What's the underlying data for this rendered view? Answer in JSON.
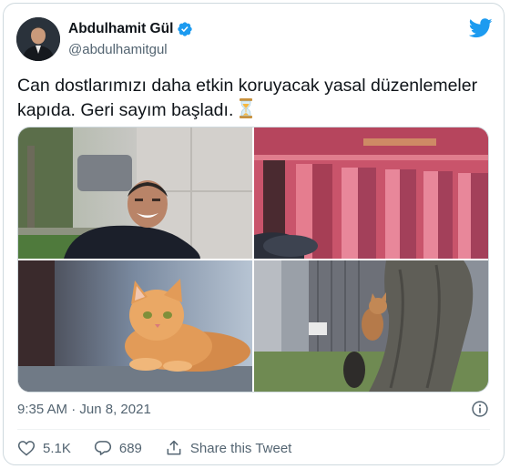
{
  "author": {
    "display_name": "Abdulhamit Gül",
    "handle": "@abdulhamitgul",
    "verified": true
  },
  "tweet": {
    "text": "Can dostlarımızı daha etkin koruyacak yasal düzenlemeler kapıda. Geri sayım başladı."
  },
  "media": {
    "photos": [
      {
        "subject": "man-crouching-smiling"
      },
      {
        "subject": "pink-building-facade"
      },
      {
        "subject": "orange-kitten"
      },
      {
        "subject": "kitten-climbing-tree"
      }
    ]
  },
  "meta": {
    "time": "9:35 AM",
    "separator": " · ",
    "date": "Jun 8, 2021"
  },
  "actions": {
    "likes": "5.1K",
    "replies": "689",
    "share_label": "Share this Tweet"
  },
  "colors": {
    "twitter_blue": "#1d9bf0",
    "text_primary": "#0f1419",
    "text_secondary": "#536471"
  },
  "icons": [
    "verified-badge-icon",
    "twitter-bird-icon",
    "hourglass-icon",
    "info-icon",
    "heart-icon",
    "reply-icon",
    "share-icon"
  ]
}
